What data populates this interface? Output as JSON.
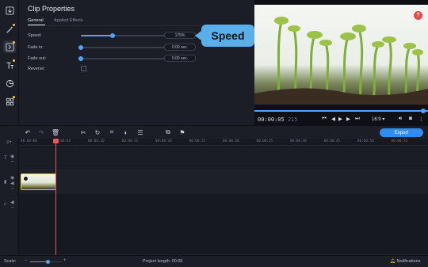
{
  "app": {
    "accent_color": "#4fa3ff",
    "export_color": "#2f8cf0",
    "playhead_color": "#e05a5a",
    "clip_border_color": "#e8d14a"
  },
  "rail": {
    "items": [
      {
        "icon": "import-icon",
        "dot": false
      },
      {
        "icon": "magic-wand-icon",
        "dot": true
      },
      {
        "icon": "transition-icon",
        "dot": true
      },
      {
        "icon": "titles-icon",
        "dot": true
      },
      {
        "icon": "stickers-icon",
        "dot": false
      },
      {
        "icon": "more-tools-icon",
        "dot": true
      }
    ]
  },
  "properties": {
    "title": "Clip Properties",
    "tabs": [
      "General",
      "Applied Effects"
    ],
    "active_tab": "General",
    "speed": {
      "label": "Speed:",
      "value": "175%",
      "level": 0.33
    },
    "fade_in": {
      "label": "Fade in:",
      "value": "0.00 sec.",
      "level": 0
    },
    "fade_out": {
      "label": "Fade out:",
      "value": "0.00 sec.",
      "level": 0
    },
    "reverse": {
      "label": "Reverse:",
      "checked": false
    }
  },
  "callout": {
    "text": "Speed"
  },
  "preview": {
    "help": "?",
    "timecode": "00:00:05",
    "timecode_frames": "215",
    "aspect": "16:9 ▾",
    "progress": 1.0
  },
  "timeline": {
    "ruler": [
      "00:00:00",
      "00:00:05",
      "00:00:10",
      "00:00:15",
      "00:00:20",
      "00:00:25",
      "00:00:30",
      "00:00:35",
      "00:00:40",
      "00:00:45",
      "00:00:50",
      "00:00:55"
    ]
  },
  "toolbar": {
    "export_label": "Export"
  },
  "status": {
    "scale_label": "Scale:",
    "scale_level": 0.55,
    "project_length": "Project length:  00:05",
    "notifications": "Notifications"
  }
}
